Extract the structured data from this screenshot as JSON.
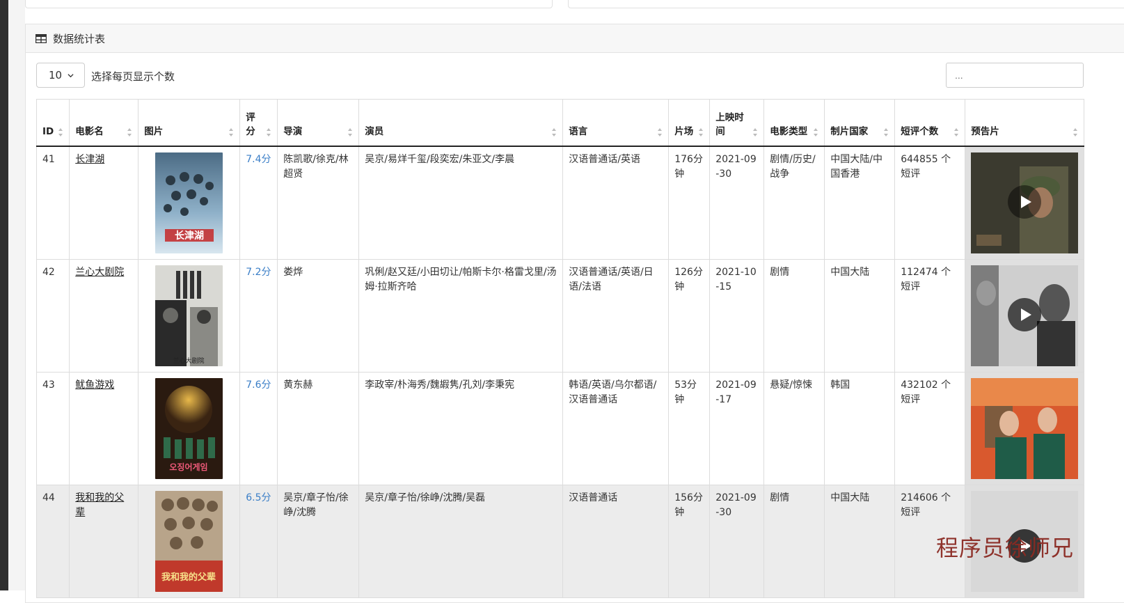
{
  "panel": {
    "title": "数据统计表",
    "icon": "table-icon"
  },
  "controls": {
    "page_size": "10",
    "page_size_label": "选择每页显示个数",
    "search_placeholder": "..."
  },
  "columns": [
    "ID",
    "电影名",
    "图片",
    "评分",
    "导演",
    "演员",
    "语言",
    "片场",
    "上映时间",
    "电影类型",
    "制片国家",
    "短评个数",
    "预告片"
  ],
  "rows": [
    {
      "id": "41",
      "name": "长津湖",
      "score": "7.4分",
      "director": "陈凯歌/徐克/林超贤",
      "actors": "吴京/易烊千玺/段奕宏/朱亚文/李晨",
      "language": "汉语普通话/英语",
      "duration": "176分钟",
      "release": "2021-09-30",
      "genre": "剧情/历史/战争",
      "country": "中国大陆/中国香港",
      "reviews": "644855 个短评",
      "poster_text": "长津湖"
    },
    {
      "id": "42",
      "name": "兰心大剧院",
      "score": "7.2分",
      "director": "娄烨",
      "actors": "巩俐/赵又廷/小田切让/帕斯卡尔·格雷戈里/汤姆·拉斯齐哈",
      "language": "汉语普通话/英语/日语/法语",
      "duration": "126分钟",
      "release": "2021-10-15",
      "genre": "剧情",
      "country": "中国大陆",
      "reviews": "112474 个短评",
      "poster_text": "兰心大剧院"
    },
    {
      "id": "43",
      "name": "鱿鱼游戏",
      "score": "7.6分",
      "director": "黄东赫",
      "actors": "李政宰/朴海秀/魏嘏隽/孔刘/李秉宪",
      "language": "韩语/英语/乌尔都语/汉语普通话",
      "duration": "53分钟",
      "release": "2021-09-17",
      "genre": "悬疑/惊悚",
      "country": "韩国",
      "reviews": "432102 个短评",
      "poster_text": "오징어게임"
    },
    {
      "id": "44",
      "name": "我和我的父辈",
      "score": "6.5分",
      "director": "吴京/章子怡/徐峥/沈腾",
      "actors": "吴京/章子怡/徐峥/沈腾/吴磊",
      "language": "汉语普通话",
      "duration": "156分钟",
      "release": "2021-09-30",
      "genre": "剧情",
      "country": "中国大陆",
      "reviews": "214606 个短评",
      "poster_text": "我和我的父辈"
    }
  ],
  "colors": {
    "score": "#3a7ec7",
    "watermark": "#8b2a22"
  },
  "watermark": "程序员徐师兄"
}
